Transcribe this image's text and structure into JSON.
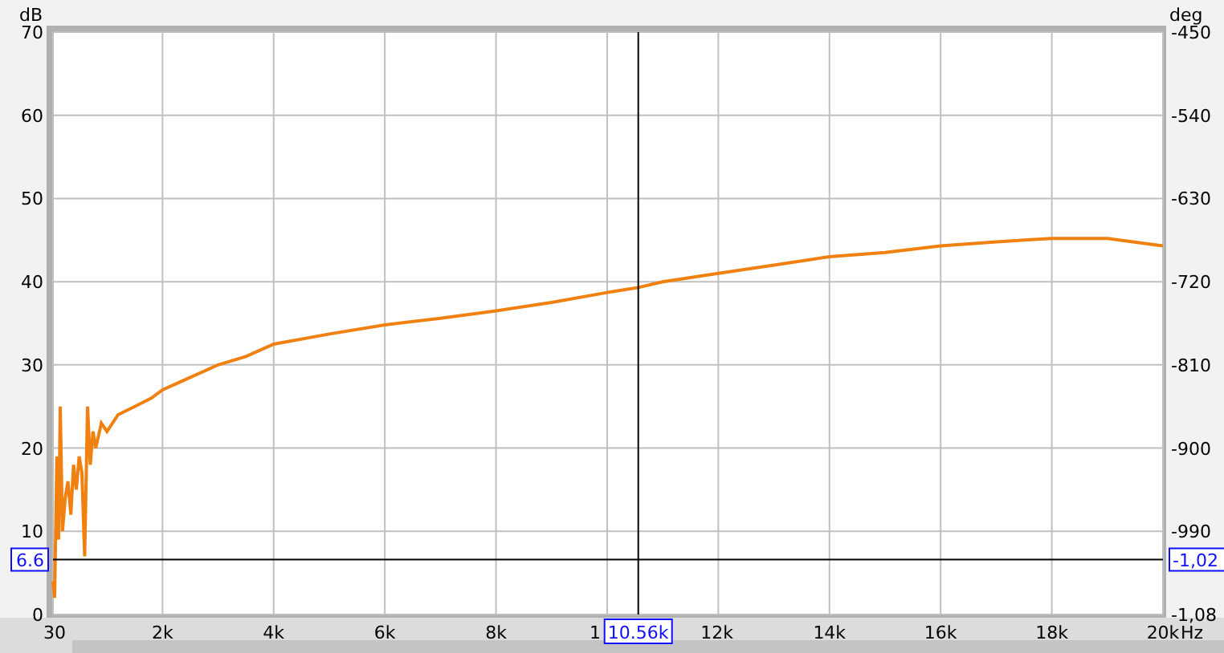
{
  "chart_data": {
    "type": "line",
    "ylabel": "dB",
    "xlim": [
      30,
      20000
    ],
    "ylim": [
      0,
      70
    ],
    "grid": true,
    "xticks": [
      {
        "value": 30,
        "label": "30"
      },
      {
        "value": 2000,
        "label": "2k"
      },
      {
        "value": 4000,
        "label": "4k"
      },
      {
        "value": 6000,
        "label": "6k"
      },
      {
        "value": 8000,
        "label": "8k"
      },
      {
        "value": 12000,
        "label": "12k"
      },
      {
        "value": 14000,
        "label": "14k"
      },
      {
        "value": 16000,
        "label": "16k"
      },
      {
        "value": 18000,
        "label": "18k"
      },
      {
        "value": 20000,
        "label": "20k"
      }
    ],
    "xlabel": "Hz",
    "yticks": [
      0,
      10,
      20,
      30,
      40,
      50,
      60,
      70
    ],
    "x": [
      30,
      60,
      100,
      130,
      160,
      200,
      250,
      300,
      350,
      400,
      450,
      500,
      550,
      600,
      650,
      700,
      750,
      800,
      900,
      1000,
      1200,
      1500,
      1800,
      2000,
      2500,
      3000,
      3500,
      4000,
      5000,
      6000,
      7000,
      8000,
      9000,
      10000,
      10560,
      11000,
      12000,
      13000,
      14000,
      15000,
      16000,
      17000,
      18000,
      19000,
      20000
    ],
    "series": [
      {
        "color": "#f08010",
        "values": [
          4,
          2,
          19,
          9,
          25,
          10,
          14,
          16,
          12,
          18,
          15,
          19,
          17,
          7,
          25,
          18,
          22,
          20,
          23,
          22,
          24,
          25,
          26,
          27,
          28.5,
          30,
          31,
          32.5,
          33.7,
          34.8,
          35.6,
          36.5,
          37.5,
          38.7,
          39.3,
          40,
          41,
          42,
          43,
          43.5,
          44.3,
          44.8,
          45.2,
          45.2,
          44.3
        ]
      }
    ],
    "ref_lines": [
      {
        "axis": "x",
        "value": 10560,
        "label": "10.56k"
      },
      {
        "axis": "y",
        "value": 6.6,
        "label": "6.6"
      }
    ]
  },
  "x_axis": {
    "covered_tick_label": "1"
  },
  "right_axis": {
    "label": "deg",
    "ticks": [
      "-450",
      "-540",
      "-630",
      "-720",
      "-810",
      "-900",
      "-990",
      "-1,08"
    ],
    "cursor_readout": "-1,02"
  }
}
